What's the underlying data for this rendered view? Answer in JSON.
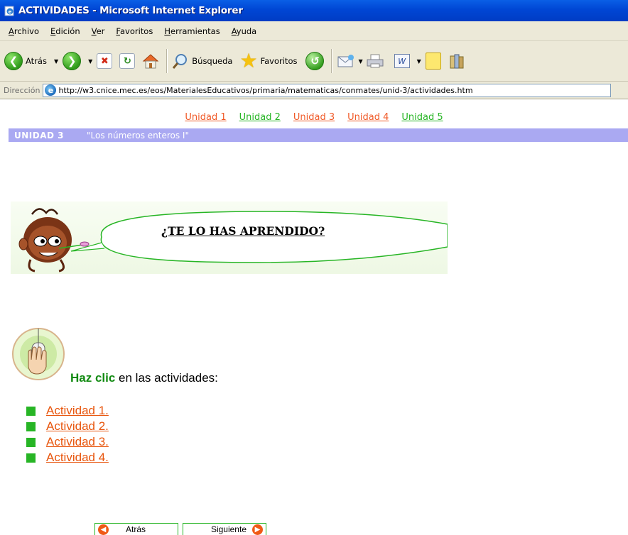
{
  "window": {
    "title": "ACTIVIDADES - Microsoft Internet Explorer"
  },
  "menu": {
    "items": [
      "Archivo",
      "Edición",
      "Ver",
      "Favoritos",
      "Herramientas",
      "Ayuda"
    ]
  },
  "toolbar": {
    "back_label": "Atrás",
    "search_label": "Búsqueda",
    "favorites_label": "Favoritos",
    "icons": [
      "back-icon",
      "forward-icon",
      "stop-icon",
      "refresh-icon",
      "home-icon",
      "search-icon",
      "favorites-icon",
      "history-icon",
      "mail-icon",
      "print-icon",
      "word-icon",
      "note-icon",
      "research-icon"
    ]
  },
  "address": {
    "label": "Dirección",
    "url": "http://w3.cnice.mec.es/eos/MaterialesEducativos/primaria/matematicas/conmates/unid-3/actividades.htm"
  },
  "units": [
    {
      "label": "Unidad 1",
      "color": "#f05a28"
    },
    {
      "label": "Unidad 2",
      "color": "#27b525"
    },
    {
      "label": "Unidad 3",
      "color": "#f05a28"
    },
    {
      "label": "Unidad 4",
      "color": "#f05a28"
    },
    {
      "label": "Unidad 5",
      "color": "#27b525"
    }
  ],
  "unit_header": {
    "code": "UNIDAD 3",
    "title": "\"Los números enteros I\""
  },
  "banner": {
    "text": "¿TE LO HAS APRENDIDO?"
  },
  "instruction": {
    "emphasis": "Haz clic",
    "rest": " en las actividades:"
  },
  "activities": [
    "Actividad 1.",
    "Actividad 2.",
    "Actividad 3.",
    "Actividad 4."
  ],
  "nav": {
    "back_label": "Atrás",
    "next_label": "Siguiente"
  },
  "colors": {
    "accent_green": "#27b525",
    "accent_orange": "#f05a28",
    "unit_bar": "#aaa9f2"
  }
}
